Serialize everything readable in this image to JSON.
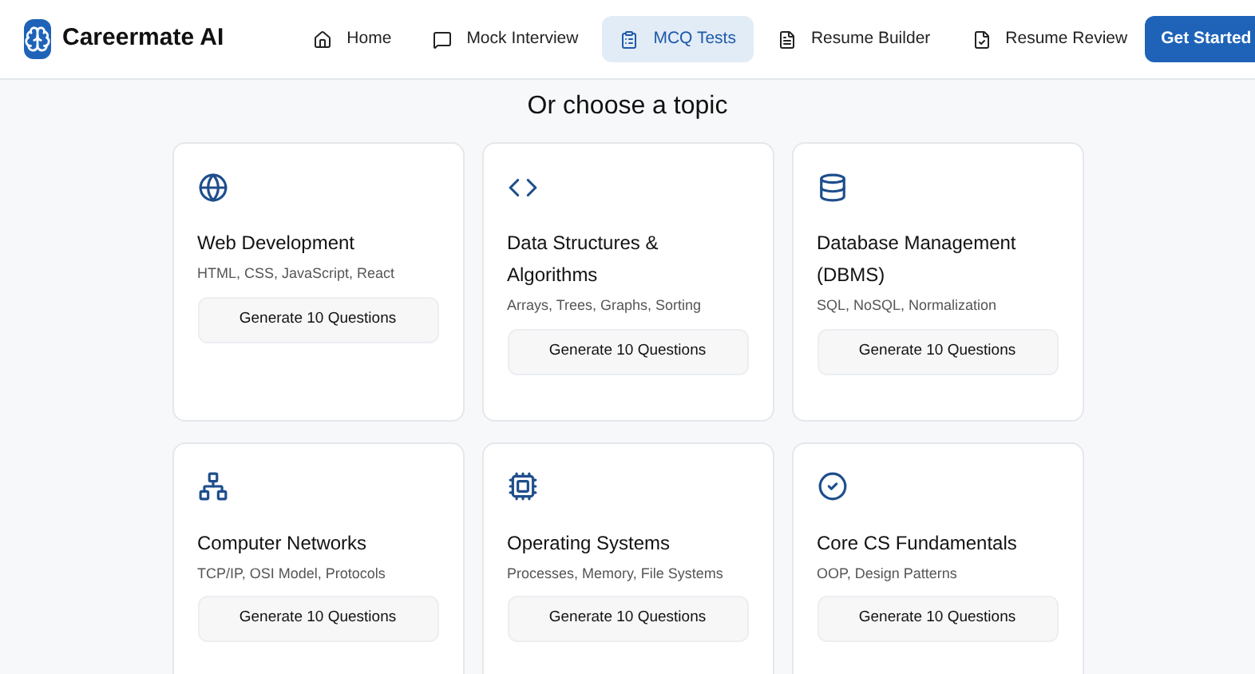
{
  "brand": {
    "name": "Careermate AI"
  },
  "nav": [
    {
      "label": "Home",
      "kind": "home",
      "selected": false
    },
    {
      "label": "Mock Interview",
      "kind": "chat",
      "selected": false
    },
    {
      "label": "MCQ Tests",
      "kind": "clipboard",
      "selected": true
    },
    {
      "label": "Resume Builder",
      "kind": "document",
      "selected": false
    },
    {
      "label": "Resume Review",
      "kind": "review",
      "selected": false
    }
  ],
  "cta": "Get Started",
  "heading": "Or choose a topic",
  "topics": [
    {
      "kind": "web",
      "title": "Web Development",
      "subtitle": "HTML, CSS, JavaScript, React",
      "button": "Generate 10 Questions"
    },
    {
      "kind": "code",
      "title": "Data Structures & Algorithms",
      "subtitle": "Arrays, Trees, Graphs, Sorting",
      "button": "Generate 10 Questions"
    },
    {
      "kind": "database",
      "title": "Database Management (DBMS)",
      "subtitle": "SQL, NoSQL, Normalization",
      "button": "Generate 10 Questions"
    },
    {
      "kind": "network",
      "title": "Computer Networks",
      "subtitle": "TCP/IP, OSI Model, Protocols",
      "button": "Generate 10 Questions"
    },
    {
      "kind": "chip",
      "title": "Operating Systems",
      "subtitle": "Processes, Memory, File Systems",
      "button": "Generate 10 Questions"
    },
    {
      "kind": "check",
      "title": "Core CS Fundamentals",
      "subtitle": "OOP, Design Patterns",
      "button": "Generate 10 Questions"
    }
  ]
}
